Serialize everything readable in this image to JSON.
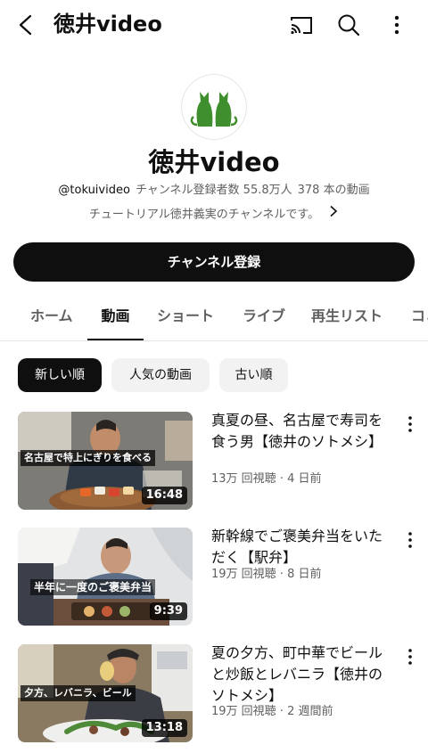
{
  "header": {
    "title": "徳井video"
  },
  "channel": {
    "name": "徳井video",
    "handle": "@tokuivideo",
    "subscribers": "チャンネル登録者数 55.8万人",
    "video_count": "378 本の動画",
    "description": "チュートリアル徳井義実のチャンネルです。",
    "subscribe_label": "チャンネル登録"
  },
  "tabs": [
    "ホーム",
    "動画",
    "ショート",
    "ライブ",
    "再生リスト",
    "コミュニティ"
  ],
  "chips": [
    "新しい順",
    "人気の動画",
    "古い順"
  ],
  "videos": [
    {
      "title": "真夏の昼、名古屋で寿司を食う男【徳井のソトメシ】",
      "meta": "13万 回視聴 · 4 日前",
      "caption": "名古屋で特上にぎりを食べる",
      "duration": "16:48"
    },
    {
      "title": "新幹線でご褒美弁当をいただく【駅弁】",
      "meta": "19万 回視聴 · 8 日前",
      "caption": "半年に一度のご褒美弁当",
      "duration": "9:39"
    },
    {
      "title": "夏の夕方、町中華でビールと炒飯とレバニラ【徳井のソトメシ】",
      "meta": "19万 回視聴 · 2 週間前",
      "caption": "夕方、レバニラ、ビール",
      "duration": "13:18"
    }
  ],
  "colors": {
    "primary_text": "#0f0f0f",
    "secondary_text": "#606060",
    "chip_bg": "#f2f2f2",
    "logo_green": "#3f8f2f"
  }
}
